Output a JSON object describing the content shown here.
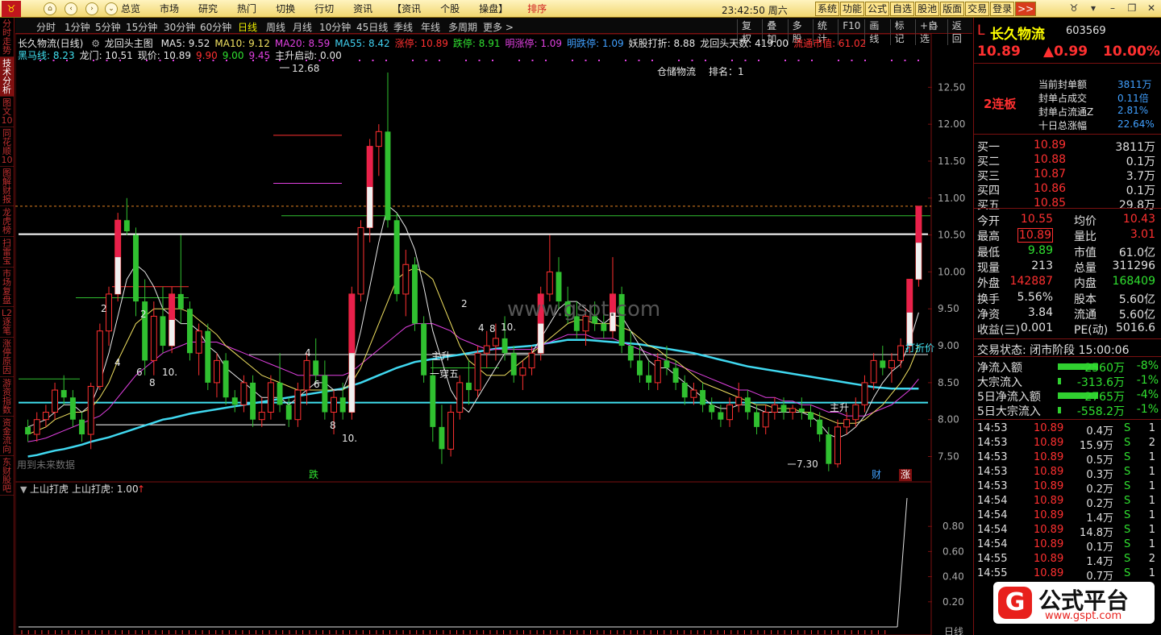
{
  "topbar": {
    "logo_icon": "bull-logo-icon",
    "menu": [
      "总览",
      "市场",
      "研究",
      "热门",
      "切换",
      "行切",
      "资讯",
      "【资讯",
      "个股",
      "操盘】",
      "排序"
    ],
    "clock": "23:42:50 周六",
    "buttons": [
      "系统",
      "功能",
      "公式",
      "自选",
      "股池",
      "版面",
      "交易",
      "登录",
      ">>"
    ]
  },
  "sidebar": [
    "分时走势",
    "技术分析",
    "图文10",
    "同花顺10",
    "图解财报",
    "龙虎榜",
    "扫雷宝",
    "市场复盘",
    "L2逐笔",
    "涨停原因",
    "游资指数",
    "资金流向",
    "东财股吧"
  ],
  "tabs": [
    "分时",
    "1分钟",
    "5分钟",
    "15分钟",
    "30分钟",
    "60分钟",
    "日线",
    "周线",
    "月线",
    "10分钟",
    "45日线",
    "季线",
    "年线",
    "多周期",
    "更多 >"
  ],
  "right_tabs": [
    "复权",
    "叠加",
    "多股",
    "统计",
    "F10",
    "画线",
    "标记",
    "+自选",
    "返回"
  ],
  "header": {
    "stock": "长久物流(日线)",
    "formula": "龙回头主图"
  },
  "indicators1": [
    {
      "t": "MA5: 9.52",
      "c": "#e8e8e8"
    },
    {
      "t": "MA10: 9.12",
      "c": "#f0e060"
    },
    {
      "t": "MA20: 8.59",
      "c": "#e040e0"
    },
    {
      "t": "MA55: 8.42",
      "c": "#40d0f0"
    },
    {
      "t": "涨停: 10.89",
      "c": "#ff3030"
    },
    {
      "t": "跌停: 8.91",
      "c": "#30e030"
    },
    {
      "t": "明涨停: 1.09",
      "c": "#e040e0"
    },
    {
      "t": "明跌停: 1.09",
      "c": "#40a0ff"
    },
    {
      "t": "妖股打折: 8.88",
      "c": "#e8e8e8"
    },
    {
      "t": "龙回头天数: 419.00",
      "c": "#e8e8e8"
    },
    {
      "t": "流通市值: 61.02",
      "c": "#ff3030"
    }
  ],
  "indicators2": [
    {
      "t": "黑马线: 8.23",
      "c": "#40e0f0"
    },
    {
      "t": "龙门: 10.51",
      "c": "#e8e8e8"
    },
    {
      "t": "现价: 10.89",
      "c": "#e8e8e8"
    },
    {
      "t": "9.90",
      "c": "#ff3030"
    },
    {
      "t": "9.00",
      "c": "#30e030"
    },
    {
      "t": "9.45",
      "c": "#e040e0"
    },
    {
      "t": "主升启动: 0.00",
      "c": "#e8e8e8"
    }
  ],
  "chart_data": {
    "type": "candlestick",
    "ylim": [
      7.2,
      12.7
    ],
    "yticks": [
      "12.50",
      "12.00",
      "11.50",
      "11.00",
      "10.50",
      "10.00",
      "9.50",
      "9.00",
      "8.50",
      "8.00",
      "7.50"
    ],
    "candles": [
      [
        7.9,
        8.0,
        7.7,
        7.8
      ],
      [
        7.8,
        8.1,
        7.7,
        8.0
      ],
      [
        8.0,
        8.2,
        7.9,
        8.1
      ],
      [
        8.1,
        8.5,
        8.0,
        8.4
      ],
      [
        8.4,
        8.6,
        8.2,
        8.3
      ],
      [
        8.3,
        8.4,
        7.9,
        8.0
      ],
      [
        8.0,
        8.1,
        7.7,
        7.8
      ],
      [
        7.8,
        8.5,
        7.6,
        8.45
      ],
      [
        8.45,
        9.3,
        8.4,
        9.2
      ],
      [
        9.2,
        9.8,
        9.0,
        9.7
      ],
      [
        9.7,
        10.8,
        9.6,
        10.7
      ],
      [
        10.7,
        11.0,
        10.5,
        10.55
      ],
      [
        10.5,
        10.6,
        9.4,
        9.6
      ],
      [
        9.6,
        9.9,
        8.6,
        8.8
      ],
      [
        8.8,
        9.6,
        8.6,
        9.4
      ],
      [
        9.4,
        9.8,
        8.9,
        9.0
      ],
      [
        9.0,
        9.8,
        8.9,
        9.7
      ],
      [
        9.7,
        10.5,
        9.3,
        9.5
      ],
      [
        9.5,
        9.6,
        8.8,
        8.9
      ],
      [
        8.9,
        9.3,
        8.6,
        9.2
      ],
      [
        9.2,
        9.3,
        8.4,
        8.5
      ],
      [
        8.5,
        8.9,
        8.3,
        8.8
      ],
      [
        8.8,
        8.9,
        8.2,
        8.3
      ],
      [
        8.3,
        8.4,
        8.1,
        8.2
      ],
      [
        8.2,
        8.6,
        8.1,
        8.5
      ],
      [
        8.5,
        8.6,
        7.9,
        8.0
      ],
      [
        8.0,
        8.3,
        7.9,
        8.1
      ],
      [
        8.1,
        8.6,
        8.0,
        8.5
      ],
      [
        8.5,
        8.9,
        8.1,
        8.2
      ],
      [
        8.2,
        8.3,
        7.9,
        8.0
      ],
      [
        8.0,
        8.5,
        7.9,
        8.4
      ],
      [
        8.4,
        8.9,
        8.2,
        8.8
      ],
      [
        8.8,
        9.1,
        8.5,
        8.6
      ],
      [
        8.6,
        8.8,
        8.0,
        8.1
      ],
      [
        8.1,
        8.4,
        7.8,
        8.3
      ],
      [
        8.3,
        8.5,
        8.0,
        8.1
      ],
      [
        8.1,
        9.8,
        8.0,
        9.7
      ],
      [
        9.7,
        10.7,
        9.6,
        10.6
      ],
      [
        10.6,
        11.8,
        10.4,
        11.7
      ],
      [
        11.7,
        12.0,
        11.3,
        11.9
      ],
      [
        11.9,
        12.7,
        10.6,
        10.7
      ],
      [
        10.7,
        10.8,
        9.6,
        9.7
      ],
      [
        9.7,
        10.3,
        9.4,
        10.1
      ],
      [
        10.1,
        10.2,
        9.2,
        9.3
      ],
      [
        9.3,
        9.4,
        8.5,
        8.6
      ],
      [
        8.6,
        8.8,
        7.7,
        7.9
      ],
      [
        7.9,
        8.2,
        7.4,
        7.6
      ],
      [
        7.6,
        8.2,
        7.5,
        8.1
      ],
      [
        8.1,
        8.6,
        8.0,
        8.5
      ],
      [
        8.5,
        8.8,
        8.2,
        8.4
      ],
      [
        8.4,
        9.0,
        8.3,
        8.9
      ],
      [
        8.9,
        9.2,
        8.7,
        9.0
      ],
      [
        9.0,
        9.3,
        8.8,
        9.1
      ],
      [
        9.1,
        9.4,
        8.8,
        8.9
      ],
      [
        8.9,
        9.0,
        8.5,
        8.6
      ],
      [
        8.6,
        8.8,
        8.4,
        8.7
      ],
      [
        8.7,
        9.0,
        8.6,
        8.9
      ],
      [
        8.9,
        9.8,
        8.8,
        9.7
      ],
      [
        9.7,
        10.5,
        9.6,
        10.0
      ],
      [
        10.0,
        10.2,
        9.5,
        9.6
      ],
      [
        9.6,
        9.8,
        9.3,
        9.4
      ],
      [
        9.4,
        9.6,
        9.1,
        9.2
      ],
      [
        9.2,
        9.5,
        9.0,
        9.4
      ],
      [
        9.4,
        9.6,
        9.2,
        9.3
      ],
      [
        9.3,
        9.5,
        9.1,
        9.2
      ],
      [
        9.2,
        10.2,
        9.1,
        9.7
      ],
      [
        9.7,
        9.8,
        8.9,
        9.0
      ],
      [
        9.0,
        9.2,
        8.7,
        8.8
      ],
      [
        8.8,
        9.0,
        8.5,
        8.6
      ],
      [
        8.6,
        8.8,
        8.4,
        8.5
      ],
      [
        8.5,
        8.9,
        8.4,
        8.8
      ],
      [
        8.8,
        9.0,
        8.6,
        8.7
      ],
      [
        8.7,
        8.8,
        8.4,
        8.5
      ],
      [
        8.5,
        8.6,
        8.2,
        8.3
      ],
      [
        8.3,
        8.5,
        8.2,
        8.4
      ],
      [
        8.4,
        8.5,
        8.1,
        8.2
      ],
      [
        8.2,
        8.3,
        8.0,
        8.1
      ],
      [
        8.1,
        8.2,
        7.9,
        8.0
      ],
      [
        8.0,
        8.3,
        7.9,
        8.2
      ],
      [
        8.2,
        8.5,
        8.1,
        8.3
      ],
      [
        8.3,
        8.4,
        8.0,
        8.1
      ],
      [
        8.1,
        8.2,
        7.8,
        7.9
      ],
      [
        7.9,
        8.2,
        7.8,
        8.1
      ],
      [
        8.1,
        8.3,
        8.0,
        8.2
      ],
      [
        8.2,
        8.3,
        8.0,
        8.1
      ],
      [
        8.1,
        8.2,
        8.0,
        8.15
      ],
      [
        8.15,
        8.3,
        8.0,
        8.1
      ],
      [
        8.1,
        8.2,
        7.9,
        8.0
      ],
      [
        8.0,
        8.1,
        7.7,
        7.8
      ],
      [
        7.8,
        7.9,
        7.3,
        7.4
      ],
      [
        7.4,
        8.0,
        7.35,
        7.9
      ],
      [
        7.9,
        8.1,
        7.8,
        8.0
      ],
      [
        8.0,
        8.3,
        7.9,
        8.2
      ],
      [
        8.2,
        8.6,
        8.1,
        8.5
      ],
      [
        8.5,
        8.9,
        8.4,
        8.8
      ],
      [
        8.8,
        9.0,
        8.6,
        8.7
      ],
      [
        8.7,
        8.9,
        8.5,
        8.8
      ],
      [
        8.8,
        9.1,
        8.7,
        9.0
      ],
      [
        9.0,
        9.9,
        8.9,
        9.9
      ],
      [
        9.9,
        10.89,
        9.8,
        10.89
      ]
    ],
    "ma5": [
      7.9,
      7.95,
      8.0,
      8.1,
      8.2,
      8.2,
      8.1,
      8.2,
      8.5,
      8.9,
      9.4,
      9.9,
      10.1,
      10.0,
      9.8,
      9.5,
      9.4,
      9.3,
      9.3,
      9.2,
      9.0,
      8.9,
      8.7,
      8.6,
      8.5,
      8.4,
      8.3,
      8.3,
      8.3,
      8.2,
      8.3,
      8.4,
      8.5,
      8.5,
      8.4,
      8.4,
      8.7,
      9.2,
      9.8,
      10.4,
      10.9,
      10.8,
      10.6,
      10.3,
      9.8,
      9.2,
      8.8,
      8.4,
      8.2,
      8.1,
      8.3,
      8.5,
      8.7,
      8.9,
      8.9,
      8.9,
      8.9,
      9.1,
      9.3,
      9.5,
      9.6,
      9.6,
      9.5,
      9.4,
      9.3,
      9.4,
      9.4,
      9.2,
      9.0,
      8.8,
      8.7,
      8.7,
      8.6,
      8.5,
      8.4,
      8.3,
      8.2,
      8.15,
      8.15,
      8.2,
      8.2,
      8.15,
      8.1,
      8.1,
      8.1,
      8.1,
      8.1,
      8.05,
      7.95,
      7.8,
      7.75,
      7.8,
      7.9,
      8.05,
      8.3,
      8.5,
      8.65,
      8.75,
      9.05,
      9.45
    ],
    "ma10": [
      7.8,
      7.85,
      7.9,
      8.0,
      8.05,
      8.1,
      8.1,
      8.15,
      8.3,
      8.5,
      8.8,
      9.05,
      9.3,
      9.4,
      9.5,
      9.5,
      9.5,
      9.5,
      9.45,
      9.35,
      9.25,
      9.15,
      9.0,
      8.9,
      8.8,
      8.7,
      8.6,
      8.55,
      8.5,
      8.45,
      8.4,
      8.4,
      8.4,
      8.4,
      8.4,
      8.4,
      8.5,
      8.7,
      9.0,
      9.3,
      9.6,
      9.9,
      10.0,
      10.05,
      10.0,
      9.9,
      9.6,
      9.3,
      9.0,
      8.8,
      8.7,
      8.6,
      8.6,
      8.6,
      8.7,
      8.8,
      8.9,
      9.0,
      9.1,
      9.2,
      9.3,
      9.35,
      9.35,
      9.3,
      9.3,
      9.3,
      9.25,
      9.2,
      9.1,
      9.0,
      8.95,
      8.85,
      8.8,
      8.7,
      8.6,
      8.5,
      8.45,
      8.4,
      8.35,
      8.3,
      8.25,
      8.2,
      8.2,
      8.15,
      8.15,
      8.15,
      8.1,
      8.1,
      8.05,
      8.0,
      7.95,
      7.95,
      7.95,
      8.0,
      8.1,
      8.2,
      8.35,
      8.5,
      8.7,
      9.0
    ],
    "ma20": [
      7.7,
      7.72,
      7.75,
      7.8,
      7.85,
      7.9,
      7.95,
      8.0,
      8.05,
      8.15,
      8.3,
      8.45,
      8.6,
      8.7,
      8.8,
      8.9,
      8.95,
      9.0,
      9.05,
      9.05,
      9.05,
      9.05,
      9.0,
      8.95,
      8.9,
      8.85,
      8.8,
      8.75,
      8.7,
      8.65,
      8.6,
      8.6,
      8.6,
      8.6,
      8.6,
      8.6,
      8.65,
      8.75,
      8.85,
      8.95,
      9.05,
      9.15,
      9.25,
      9.3,
      9.3,
      9.3,
      9.25,
      9.2,
      9.1,
      9.05,
      9.0,
      8.95,
      8.95,
      8.95,
      8.95,
      8.95,
      8.95,
      9.0,
      9.05,
      9.1,
      9.15,
      9.15,
      9.15,
      9.1,
      9.1,
      9.1,
      9.05,
      9.0,
      8.95,
      8.9,
      8.85,
      8.8,
      8.75,
      8.7,
      8.65,
      8.6,
      8.55,
      8.5,
      8.45,
      8.4,
      8.4,
      8.35,
      8.3,
      8.3,
      8.25,
      8.25,
      8.2,
      8.2,
      8.15,
      8.1,
      8.1,
      8.05,
      8.05,
      8.05,
      8.1,
      8.15,
      8.2,
      8.3,
      8.4,
      8.55
    ],
    "ma55": [
      7.5,
      7.52,
      7.55,
      7.58,
      7.6,
      7.63,
      7.66,
      7.7,
      7.73,
      7.76,
      7.8,
      7.84,
      7.88,
      7.92,
      7.96,
      8.0,
      8.02,
      8.05,
      8.08,
      8.1,
      8.12,
      8.14,
      8.16,
      8.18,
      8.2,
      8.22,
      8.24,
      8.26,
      8.28,
      8.3,
      8.32,
      8.34,
      8.36,
      8.38,
      8.4,
      8.42,
      8.46,
      8.5,
      8.55,
      8.6,
      8.65,
      8.7,
      8.74,
      8.78,
      8.8,
      8.82,
      8.84,
      8.86,
      8.88,
      8.9,
      8.92,
      8.94,
      8.96,
      8.97,
      8.98,
      8.99,
      9.0,
      9.02,
      9.04,
      9.06,
      9.08,
      9.08,
      9.08,
      9.07,
      9.06,
      9.05,
      9.04,
      9.03,
      9.02,
      9.0,
      8.98,
      8.96,
      8.94,
      8.92,
      8.9,
      8.87,
      8.84,
      8.81,
      8.78,
      8.75,
      8.72,
      8.7,
      8.68,
      8.66,
      8.64,
      8.62,
      8.6,
      8.58,
      8.56,
      8.54,
      8.52,
      8.5,
      8.48,
      8.46,
      8.44,
      8.43,
      8.42,
      8.42,
      8.42,
      8.42
    ],
    "labels": [
      "12.68",
      "7.30",
      "打折价",
      "主升",
      "一穿五",
      "主升",
      "仓储物流",
      "排名：1",
      "跌",
      "财",
      "涨",
      "用到未来数据",
      "2",
      "4",
      "6",
      "8",
      "10."
    ],
    "sub": {
      "title": "上山打虎",
      "value": "上山打虎: 1.00",
      "yticks": [
        "0.80",
        "0.60",
        "0.40",
        "0.20"
      ]
    },
    "date_label": "日线"
  },
  "panel": {
    "code_prefix": "L",
    "name": "长久物流",
    "code": "603569",
    "price": "10.89",
    "change": "▲0.99",
    "pct": "10.00%",
    "badge": "2连板",
    "seal": [
      {
        "k": "当前封单额",
        "v": "3811万"
      },
      {
        "k": "封单占成交",
        "v": "0.11倍"
      },
      {
        "k": "封单占流通Z",
        "v": "2.81%"
      },
      {
        "k": "十日总涨幅",
        "v": "22.64%"
      }
    ],
    "book": [
      {
        "k": "买一",
        "p": "10.89",
        "v": "3811万"
      },
      {
        "k": "买二",
        "p": "10.88",
        "v": "0.1万"
      },
      {
        "k": "买三",
        "p": "10.87",
        "v": "3.7万"
      },
      {
        "k": "买四",
        "p": "10.86",
        "v": "0.1万"
      },
      {
        "k": "买五",
        "p": "10.85",
        "v": "29.8万"
      }
    ],
    "quote": [
      {
        "k1": "今开",
        "v1": "10.55",
        "k2": "均价",
        "v2": "10.43"
      },
      {
        "k1": "最高",
        "v1": "10.89",
        "k2": "量比",
        "v2": "3.01"
      },
      {
        "k1": "最低",
        "v1": "9.89",
        "k2": "市值",
        "v2": "61.0亿"
      },
      {
        "k1": "现量",
        "v1": "213",
        "k2": "总量",
        "v2": "311296"
      },
      {
        "k1": "外盘",
        "v1": "142887",
        "k2": "内盘",
        "v2": "168409"
      },
      {
        "k1": "换手",
        "v1": "5.56%",
        "k2": "股本",
        "v2": "5.60亿"
      },
      {
        "k1": "净资",
        "v1": "3.84",
        "k2": "流通",
        "v2": "5.60亿"
      },
      {
        "k1": "收益(三)",
        "v1": "0.001",
        "k2": "PE(动)",
        "v2": "5016.6"
      }
    ],
    "status": "交易状态: 闭市阶段 15:00:06",
    "flows": [
      {
        "k": "净流入额",
        "v": "-2560万",
        "p": "-8%"
      },
      {
        "k": "大宗流入",
        "v": "-313.6万",
        "p": "-1%"
      },
      {
        "k": "5日净流入额",
        "v": "-2765万",
        "p": "-4%"
      },
      {
        "k": "5日大宗流入",
        "v": "-558.2万",
        "p": "-1%"
      }
    ],
    "ticks": [
      {
        "t": "14:53",
        "p": "10.89",
        "v": "0.4万",
        "s": "S",
        "n": "1"
      },
      {
        "t": "14:53",
        "p": "10.89",
        "v": "15.9万",
        "s": "S",
        "n": "2"
      },
      {
        "t": "14:53",
        "p": "10.89",
        "v": "0.5万",
        "s": "S",
        "n": "1"
      },
      {
        "t": "14:53",
        "p": "10.89",
        "v": "0.3万",
        "s": "S",
        "n": "1"
      },
      {
        "t": "14:53",
        "p": "10.89",
        "v": "0.2万",
        "s": "S",
        "n": "1"
      },
      {
        "t": "14:54",
        "p": "10.89",
        "v": "0.2万",
        "s": "S",
        "n": "1"
      },
      {
        "t": "14:54",
        "p": "10.89",
        "v": "1.4万",
        "s": "S",
        "n": "1"
      },
      {
        "t": "14:54",
        "p": "10.89",
        "v": "14.8万",
        "s": "S",
        "n": "1"
      },
      {
        "t": "14:54",
        "p": "10.89",
        "v": "0.1万",
        "s": "S",
        "n": "1"
      },
      {
        "t": "14:55",
        "p": "10.89",
        "v": "1.4万",
        "s": "S",
        "n": "2"
      },
      {
        "t": "14:55",
        "p": "10.89",
        "v": "0.7万",
        "s": "S",
        "n": "1"
      }
    ],
    "watermark": {
      "big": "公式平台",
      "url": "www.gspt.com"
    }
  },
  "center_watermark": "www.gspt.com"
}
